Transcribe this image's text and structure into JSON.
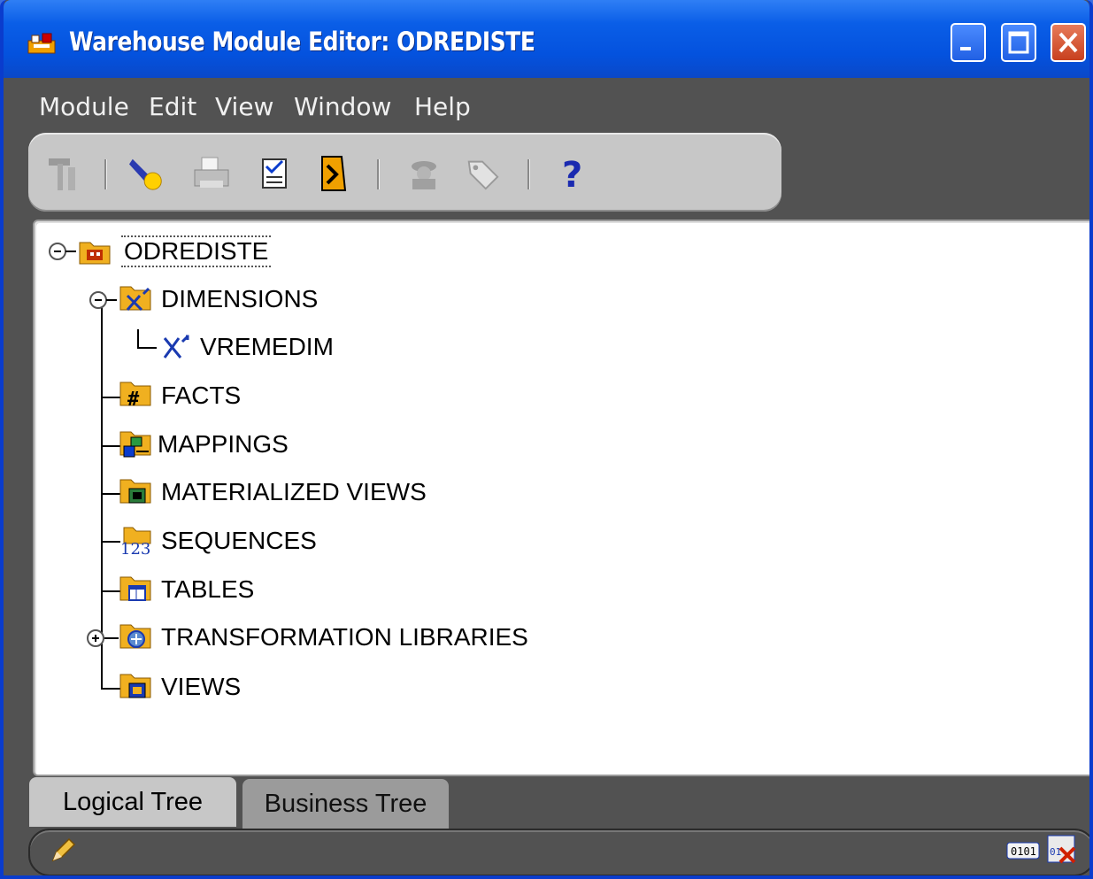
{
  "window": {
    "title": "Warehouse Module Editor: ODREDISTE",
    "colors": {
      "titlebar": "#0452de",
      "body": "#525252",
      "panel": "#ffffff",
      "close": "#c8401e"
    }
  },
  "menu": [
    "Module",
    "Edit",
    "View",
    "Window",
    "Help"
  ],
  "toolbar": {
    "buttons": [
      "build-icon",
      "flashlight-icon",
      "print-icon",
      "checklist-icon",
      "exit-door-icon",
      "spy-icon",
      "tag-icon",
      "help-icon"
    ]
  },
  "tree": {
    "root": "ODREDISTE",
    "nodes": [
      {
        "label": "DIMENSIONS",
        "icon": "dimension-folder-icon",
        "expanded": true,
        "children": [
          "VREMEDIM"
        ]
      },
      {
        "label": "FACTS",
        "icon": "facts-folder-icon"
      },
      {
        "label": "MAPPINGS",
        "icon": "mappings-folder-icon"
      },
      {
        "label": "MATERIALIZED VIEWS",
        "icon": "materialized-views-folder-icon"
      },
      {
        "label": "SEQUENCES",
        "icon": "sequences-folder-icon"
      },
      {
        "label": "TABLES",
        "icon": "tables-folder-icon"
      },
      {
        "label": "TRANSFORMATION LIBRARIES",
        "icon": "transformation-folder-icon",
        "expanded": false
      },
      {
        "label": "VIEWS",
        "icon": "views-folder-icon"
      }
    ]
  },
  "tabs": [
    "Logical Tree",
    "Business Tree"
  ],
  "status": {
    "left_icon": "pencil-icon",
    "right_icons": [
      "binary-icon",
      "binary-error-icon"
    ]
  }
}
